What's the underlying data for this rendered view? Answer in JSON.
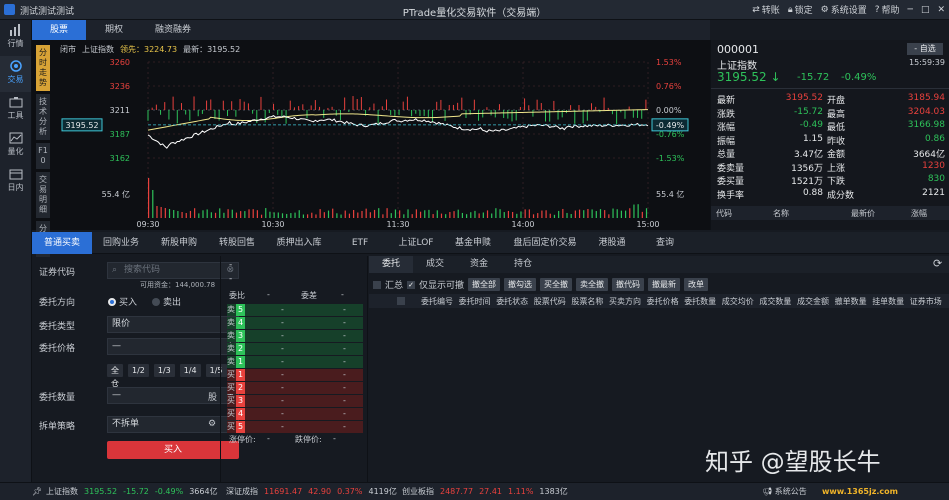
{
  "window": {
    "left_title": "测试测试测试",
    "title": "PTrade量化交易软件（交易端）",
    "actions": [
      {
        "label": "转账"
      },
      {
        "label": "锁定"
      },
      {
        "label": "系统设置"
      },
      {
        "label": "帮助"
      }
    ]
  },
  "sidebar": [
    {
      "label": "行情"
    },
    {
      "label": "交易"
    },
    {
      "label": "工具"
    },
    {
      "label": "量化"
    },
    {
      "label": "日内"
    }
  ],
  "top_tabs": [
    "股票",
    "期权",
    "融资融券"
  ],
  "vertical_tabs": [
    "分时走势",
    "技术分析",
    "F10",
    "交易明细",
    "分价表"
  ],
  "quote_header": {
    "status": "闭市",
    "name": "上证指数",
    "lead_label": "领先：3224.73",
    "latest_label": "最新：3195.52"
  },
  "chart_data": {
    "type": "line",
    "time_ticks": [
      "09:30",
      "10:30",
      "11:30",
      "14:00",
      "15:00"
    ],
    "y_left": [
      "3260",
      "3236",
      "3211",
      "3187",
      "3162"
    ],
    "y_right": [
      "1.53%",
      "0.76%",
      "0.00%",
      "-0.76%",
      "-1.53%"
    ],
    "current_price": "3195.52",
    "current_pct": "-0.49%",
    "volume_label": "55.4 亿",
    "ylim": [
      3162,
      3260
    ]
  },
  "stock": {
    "code": "000001",
    "name": "上证指数",
    "time": "15:59:39",
    "price": "3195.52",
    "change": "-15.72",
    "pct": "-0.49%",
    "self_select": "- 自选"
  },
  "stats": [
    [
      "最新",
      "3195.52",
      "开盘",
      "3185.94"
    ],
    [
      "涨跌",
      "-15.72",
      "最高",
      "3204.03"
    ],
    [
      "涨幅",
      "-0.49",
      "最低",
      "3166.98"
    ],
    [
      "振幅",
      "1.15",
      "昨收",
      "0.86"
    ],
    [
      "总量",
      "3.47亿",
      "金额",
      "3664亿"
    ],
    [
      "委卖量",
      "1356万",
      "上涨",
      "1230"
    ],
    [
      "委买量",
      "1521万",
      "下跌",
      "830"
    ],
    [
      "换手率",
      "0.88",
      "成分数",
      "2121"
    ]
  ],
  "stat_colors": [
    [
      "white",
      "red",
      "white",
      "red"
    ],
    [
      "white",
      "green",
      "white",
      "red"
    ],
    [
      "white",
      "green",
      "white",
      "green"
    ],
    [
      "white",
      "white",
      "white",
      "green"
    ],
    [
      "white",
      "white",
      "white",
      "white"
    ],
    [
      "white",
      "white",
      "white",
      "red"
    ],
    [
      "white",
      "white",
      "white",
      "green"
    ],
    [
      "white",
      "white",
      "white",
      "white"
    ]
  ],
  "mini_table_headers": [
    "代码",
    "名称",
    "最新价",
    "涨幅"
  ],
  "bottom_tabs": [
    "普通买卖",
    "回购业务",
    "新股申购",
    "转股回售",
    "质押出入库",
    "ETF",
    "上证LOF",
    "基金申赎",
    "盘后固定价交易",
    "港股通",
    "查询"
  ],
  "form": {
    "code_label": "证券代码",
    "code_placeholder": "搜索代码",
    "available": "可用资金：144,000.78",
    "direction_label": "委托方向",
    "buy": "买入",
    "sell": "卖出",
    "type_label": "委托类型",
    "type_value": "限价",
    "price_label": "委托价格",
    "ratios": [
      "全仓",
      "1/2",
      "1/3",
      "1/4",
      "1/5"
    ],
    "qty_label": "委托数量",
    "qty_unit": "股",
    "split_label": "拆单策略",
    "split_value": "不拆单",
    "submit": "买入"
  },
  "orderbook": {
    "top": "-",
    "sub": "-",
    "ratio_label": "委比",
    "ratio_value": "-",
    "diff_label": "委差",
    "diff_value": "-",
    "sells": [
      "卖5",
      "卖4",
      "卖3",
      "卖2",
      "卖1"
    ],
    "buys": [
      "买1",
      "买2",
      "买3",
      "买4",
      "买5"
    ],
    "sell_nums": [
      "5",
      "4",
      "3",
      "2",
      "1"
    ],
    "buy_nums": [
      "1",
      "2",
      "3",
      "4",
      "5"
    ],
    "limit_up": "涨停价:",
    "limit_up_val": "-",
    "limit_down": "跌停价:",
    "limit_down_val": "-"
  },
  "orders": {
    "tabs": [
      "委托",
      "成交",
      "资金",
      "持仓"
    ],
    "summary": "汇总",
    "only_cancel": "仅显示可撤",
    "buttons": [
      "撤全部",
      "撤勾选",
      "买全撤",
      "卖全撤",
      "撤代码",
      "撤最新",
      "改单"
    ],
    "columns": [
      "委托编号",
      "委托时间",
      "委托状态",
      "股票代码",
      "股票名称",
      "买卖方向",
      "委托价格",
      "委托数量",
      "成交均价",
      "成交数量",
      "成交金额",
      "撤单数量",
      "挂单数量",
      "证券市场"
    ]
  },
  "watermark": "知乎 @望股长牛",
  "site_mark": "www.1365jz.com",
  "status_bar": {
    "items": [
      {
        "name": "上证指数",
        "price": "3195.52",
        "change": "-15.72",
        "pct": "-0.49%",
        "amount": "3664亿",
        "dir": "down"
      },
      {
        "name": "深证成指",
        "price": "11691.47",
        "change": "42.90",
        "pct": "0.37%",
        "amount": "4119亿",
        "dir": "up"
      },
      {
        "name": "创业板指",
        "price": "2487.77",
        "change": "27.41",
        "pct": "1.11%",
        "amount": "1383亿",
        "dir": "up"
      }
    ],
    "notice": "系统公告"
  },
  "colors": {
    "accent": "#2b6fd6",
    "up": "#e8413d",
    "down": "#2ec25a",
    "price_line": "#f0e68c",
    "avg_line": "#ffffff"
  }
}
